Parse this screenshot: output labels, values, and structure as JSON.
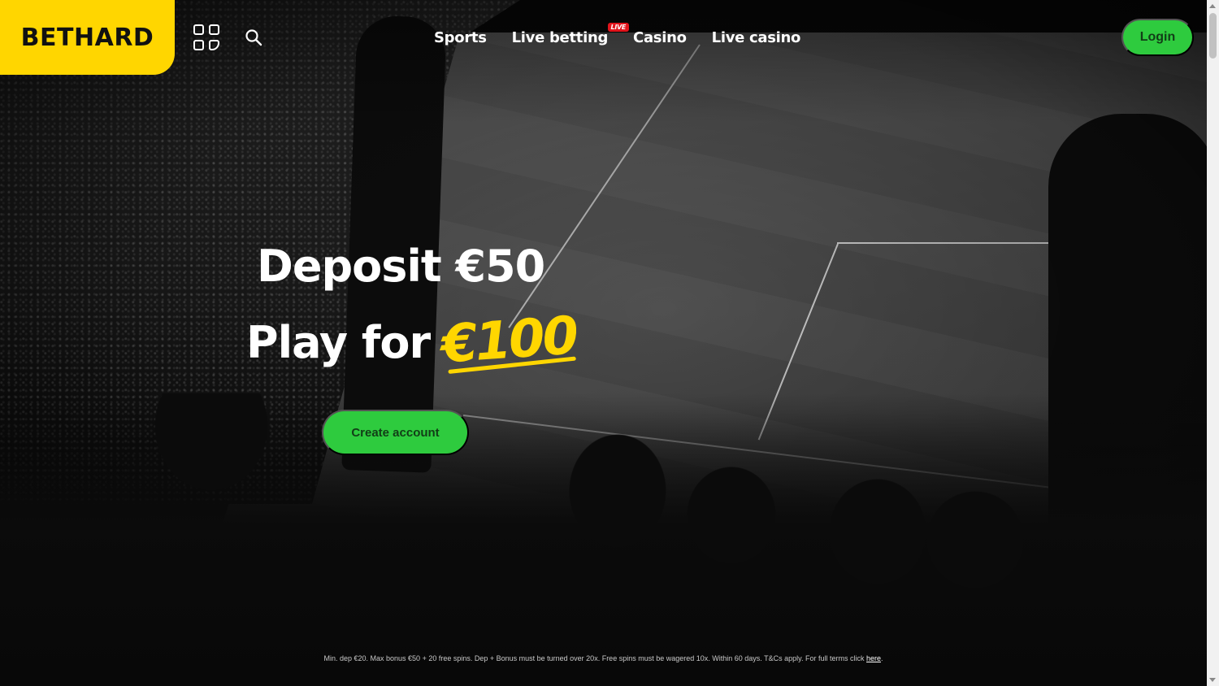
{
  "brand": {
    "logo_text": "BETHARD",
    "logo_color": "#ffd600"
  },
  "header": {
    "menu_icon": "grid-menu-icon",
    "search_icon": "search-icon",
    "nav": [
      {
        "label": "Sports"
      },
      {
        "label": "Live betting",
        "badge": "LIVE"
      },
      {
        "label": "Casino"
      },
      {
        "label": "Live casino"
      }
    ],
    "login_label": "Login"
  },
  "hero": {
    "line1": "Deposit €50",
    "line2_prefix": "Play for",
    "line2_amount": "€100",
    "cta_label": "Create account"
  },
  "footer": {
    "terms_text": "Min. dep €20. Max bonus €50 + 20 free spins. Dep + Bonus must be turned over 20x. Free spins must be wagered 10x. Within 60 days. T&Cs apply. For full terms click ",
    "terms_link": "here",
    "terms_end": "."
  },
  "colors": {
    "accent_green": "#2ecb3e",
    "accent_yellow": "#ffd600",
    "live_red": "#e1141c"
  }
}
